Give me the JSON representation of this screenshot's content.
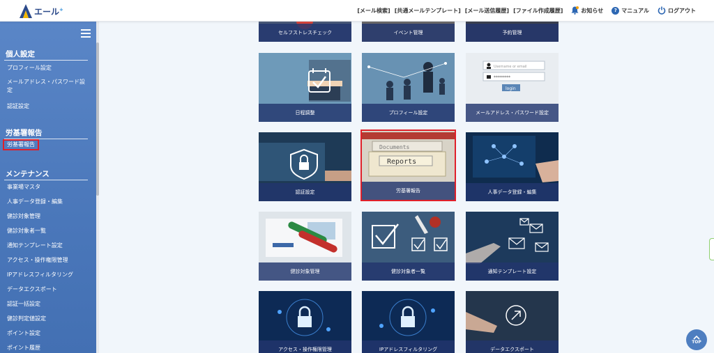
{
  "header": {
    "logo_text": "エール",
    "logo_sup": "+",
    "nav": [
      "[メール検索]",
      "[共通メールテンプレート]",
      "[メール送信履歴]",
      "[ファイル作成履歴]"
    ],
    "notice": "お知らせ",
    "manual": "マニュアル",
    "logout": "ログアウト"
  },
  "sidebar": {
    "sections": [
      {
        "title": "個人設定",
        "items": [
          "プロフィール設定",
          "メールアドレス・パスワード設定",
          "認証設定"
        ]
      },
      {
        "title": "労基署報告",
        "items": [
          "労基署報告"
        ]
      },
      {
        "title": "メンテナンス",
        "items": [
          "事業場マスタ",
          "人事データ登録・編集",
          "健診対象管理",
          "健診対象者一覧",
          "通知テンプレート設定",
          "アクセス・操作権限管理",
          "IPアドレスフィルタリング",
          "データエクスポート",
          "認証一括設定",
          "健診判定値設定",
          "ポイント設定",
          "ポイント履歴"
        ]
      }
    ]
  },
  "tiles": {
    "row0": [
      "セルフストレスチェック",
      "イベント管理",
      "予約管理"
    ],
    "row1": [
      "日程調整",
      "プロフィール設定",
      "メールアドレス・パスワード設定"
    ],
    "row2": [
      "認証設定",
      "労基署報告",
      "人事データ登録・編集"
    ],
    "row3": [
      "健診対象管理",
      "健診対象者一覧",
      "通知テンプレート設定"
    ],
    "row4": [
      "アクセス・操作権限管理",
      "IPアドレスフィルタリング",
      "データエクスポート"
    ]
  },
  "tile_art": {
    "login_username": "Username or email",
    "login_password": "********",
    "login_button": "login",
    "reports_label": "Reports",
    "documents_label": "Documents"
  },
  "top_button": "TOP",
  "colors": {
    "accent": "#2d67b3",
    "sidebar": "#4a77ba",
    "highlight": "#e0202a",
    "caption": "#22366e"
  }
}
